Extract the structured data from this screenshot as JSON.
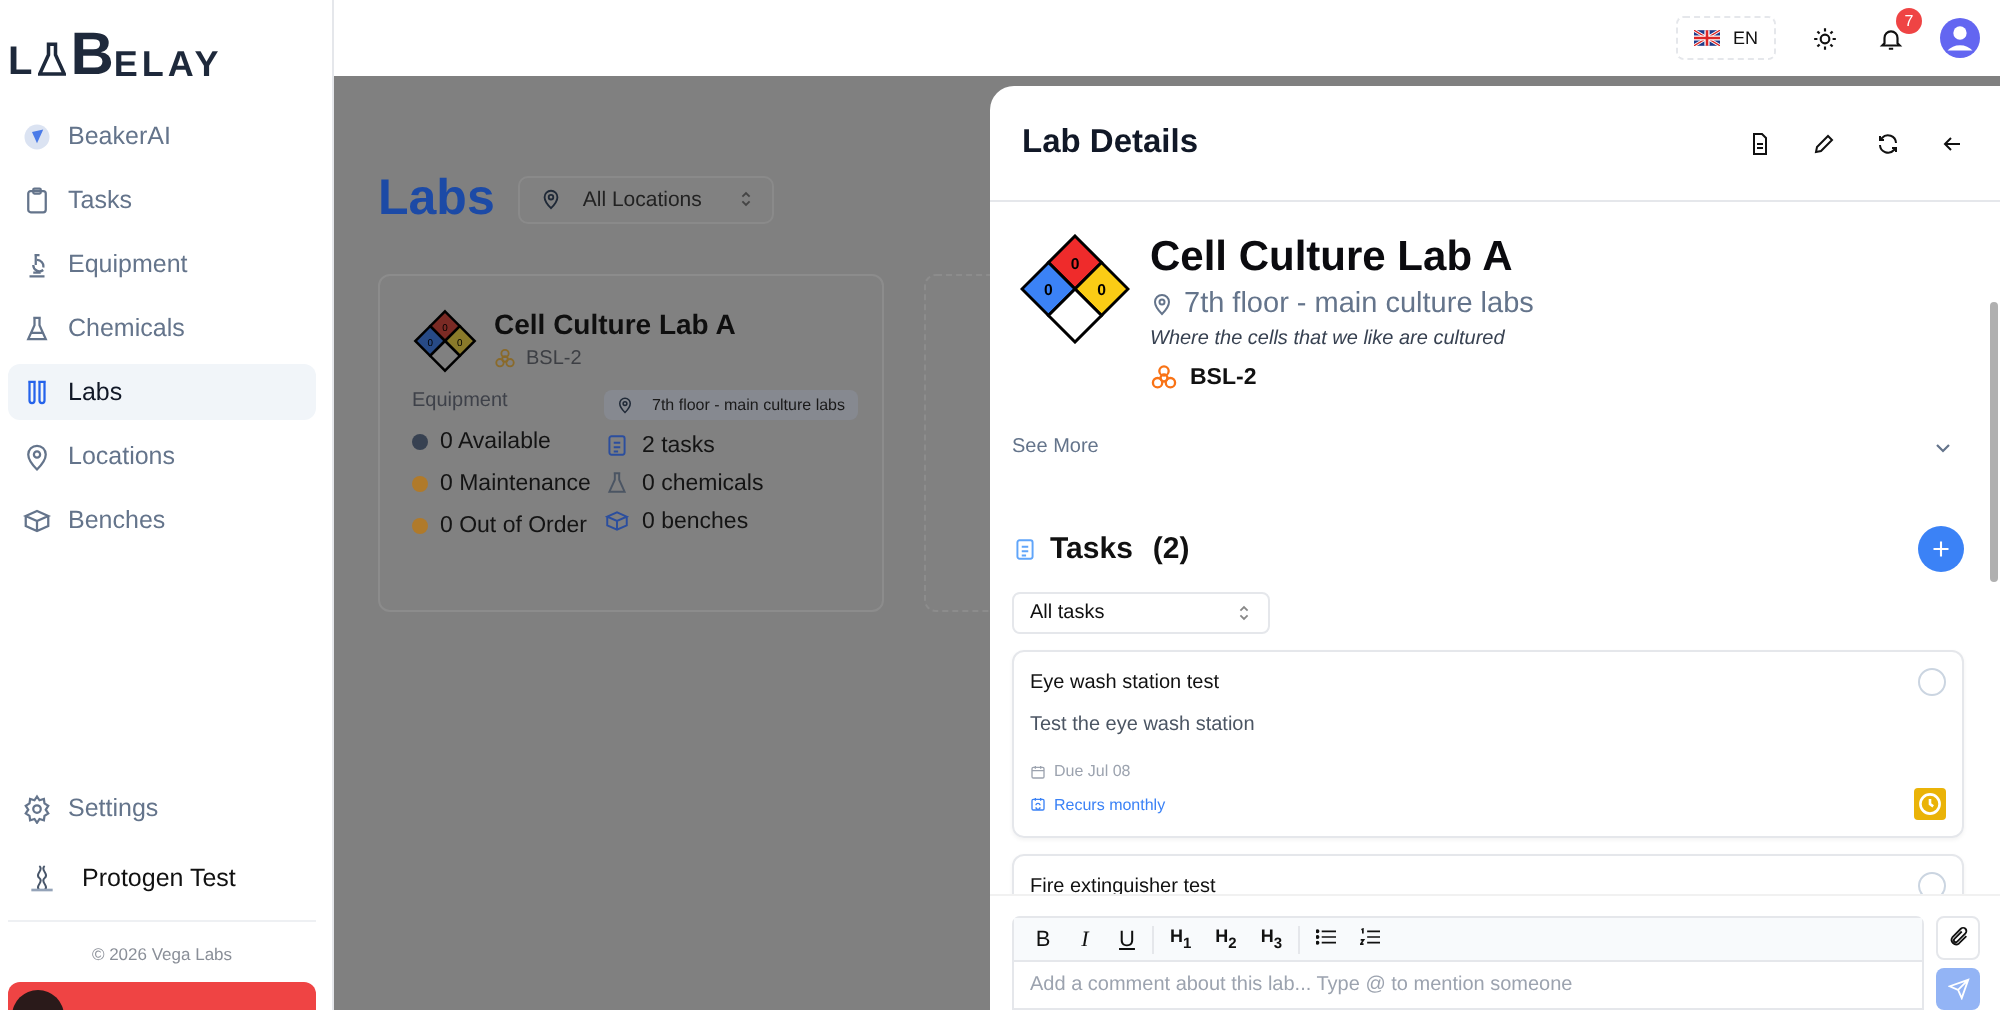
{
  "logo": {
    "lead": "L",
    "initial": "B",
    "rest": "ELAY"
  },
  "sidebar": {
    "items": [
      {
        "label": "BeakerAI",
        "kind": "beaker-ai",
        "selected": false
      },
      {
        "label": "Tasks",
        "kind": "tasks",
        "selected": false
      },
      {
        "label": "Equipment",
        "kind": "equipment",
        "selected": false
      },
      {
        "label": "Chemicals",
        "kind": "chemicals",
        "selected": false
      },
      {
        "label": "Labs",
        "kind": "labs",
        "selected": true
      },
      {
        "label": "Locations",
        "kind": "locations",
        "selected": false
      },
      {
        "label": "Benches",
        "kind": "benches",
        "selected": false
      }
    ],
    "settings": "Settings",
    "organization": "Protogen Test",
    "footer": "© 2026 Vega Labs"
  },
  "topbar": {
    "language": "EN",
    "notification_count": "7"
  },
  "page": {
    "title": "Labs",
    "location_filter": "All Locations",
    "cards": [
      {
        "name": "Cell Culture Lab A",
        "biosafety": "BSL-2",
        "hazard": {
          "health": "0",
          "flammability": "0",
          "reactivity": "0"
        },
        "equipment_label": "Equipment",
        "equipment": [
          {
            "label": "0 Available",
            "color": "#374151"
          },
          {
            "label": "0 Maintenance",
            "color": "#b07a2a"
          },
          {
            "label": "0 Out of Order",
            "color": "#b07a2a"
          }
        ],
        "location": "7th floor - main culture labs",
        "stats": [
          {
            "kind": "tasks",
            "text": "2 tasks"
          },
          {
            "kind": "chemicals",
            "text": "0 chemicals"
          },
          {
            "kind": "benches",
            "text": "0 benches"
          }
        ]
      }
    ]
  },
  "panel": {
    "title": "Lab Details",
    "lab": {
      "name": "Cell Culture Lab A",
      "location": "7th floor - main culture labs",
      "description": "Where the cells that we like are cultured",
      "biosafety": "BSL-2",
      "hazard": {
        "health": "0",
        "flammability": "0",
        "reactivity": "0"
      }
    },
    "see_more": "See More",
    "tasks": {
      "title": "Tasks",
      "count": "(2)",
      "filter": "All tasks",
      "items": [
        {
          "title": "Eye wash station test",
          "description": "Test the eye wash station",
          "due": "Due Jul 08",
          "recurrence": "Recurs monthly",
          "done": false
        },
        {
          "title": "Fire extinguisher test",
          "done": false
        }
      ]
    },
    "composer": {
      "toolbar": [
        [
          {
            "kind": "bold",
            "label": "B"
          },
          {
            "kind": "italic",
            "label": "I"
          },
          {
            "kind": "underline",
            "label": "U"
          }
        ],
        [
          {
            "kind": "heading",
            "label": "H$_{1}$"
          },
          {
            "kind": "heading",
            "label": "H$_{2}$"
          },
          {
            "kind": "heading",
            "label": "H$_{3}$"
          }
        ],
        [
          {
            "kind": "bullet-list"
          },
          {
            "kind": "ordered-list"
          }
        ]
      ],
      "placeholder": "Add a comment about this lab... Type @ to mention someone"
    }
  }
}
